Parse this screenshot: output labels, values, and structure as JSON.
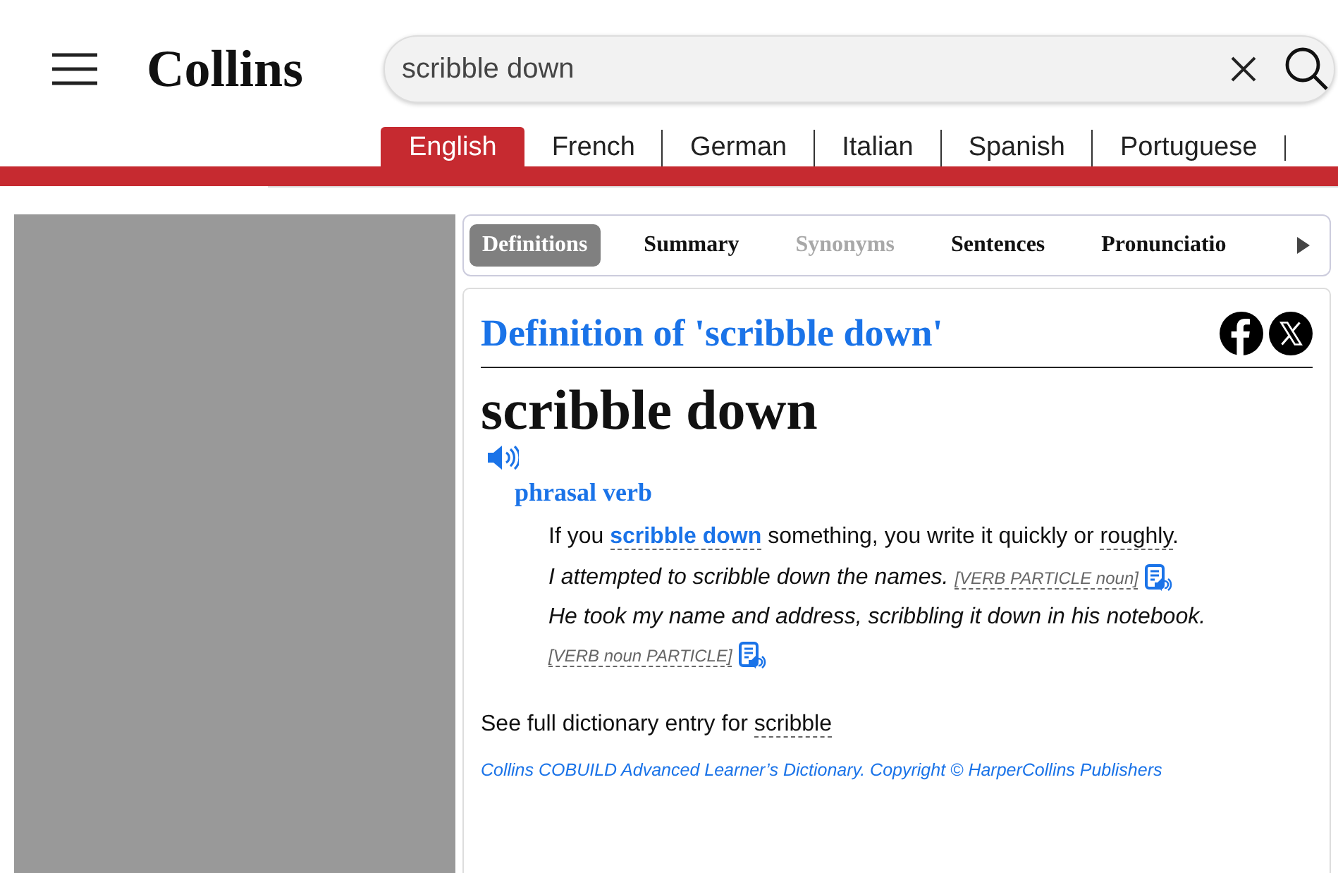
{
  "header": {
    "logo": "Collins",
    "search": {
      "value": "scribble down"
    }
  },
  "languages": [
    {
      "label": "English",
      "selected": true
    },
    {
      "label": "French",
      "selected": false
    },
    {
      "label": "German",
      "selected": false
    },
    {
      "label": "Italian",
      "selected": false
    },
    {
      "label": "Spanish",
      "selected": false
    },
    {
      "label": "Portuguese",
      "selected": false
    }
  ],
  "tabs": [
    {
      "label": "Definitions",
      "selected": true,
      "disabled": false
    },
    {
      "label": "Summary",
      "selected": false,
      "disabled": false
    },
    {
      "label": "Synonyms",
      "selected": false,
      "disabled": true
    },
    {
      "label": "Sentences",
      "selected": false,
      "disabled": false
    },
    {
      "label": "Pronunciatio",
      "selected": false,
      "disabled": false
    }
  ],
  "entry": {
    "title": "Definition of 'scribble down'",
    "headword": "scribble down",
    "part_of_speech": "phrasal verb",
    "definition": [
      {
        "kind": "text",
        "text": "If you "
      },
      {
        "kind": "link",
        "text": "scribble down"
      },
      {
        "kind": "text",
        "text": " something, you write it quickly or "
      },
      {
        "kind": "link",
        "text": "roughly"
      },
      {
        "kind": "text",
        "text": "."
      }
    ],
    "examples": [
      {
        "text": "I attempted to scribble down the names.",
        "pattern": "[VERB PARTICLE noun]"
      },
      {
        "text": "He took my name and address, scribbling it down in his notebook.",
        "pattern": "[VERB noun PARTICLE]"
      }
    ],
    "see_also": {
      "text": "See full dictionary entry for",
      "link": "scribble"
    },
    "credit": "Collins COBUILD Advanced Learner’s Dictionary. Copyright © HarperCollins Publishers"
  }
}
